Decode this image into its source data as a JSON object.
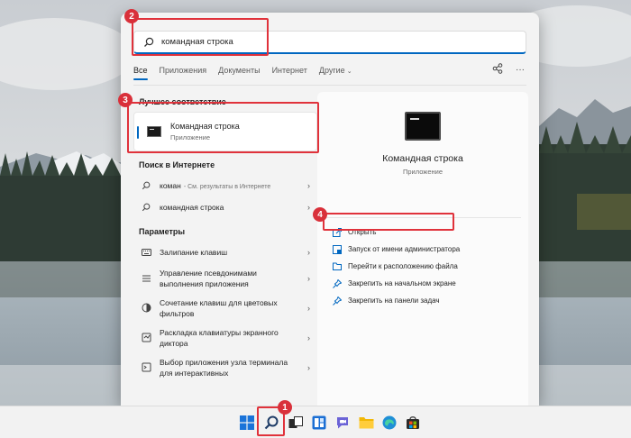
{
  "search": {
    "query": "командная строка"
  },
  "tabs": [
    {
      "label": "Все"
    },
    {
      "label": "Приложения"
    },
    {
      "label": "Документы"
    },
    {
      "label": "Интернет"
    },
    {
      "label": "Другие"
    }
  ],
  "toolbar": {
    "more_label": "···"
  },
  "best_match": {
    "section_title": "Лучшее соответствие",
    "title": "Командная строка",
    "subtitle": "Приложение"
  },
  "web": {
    "section_title": "Поиск в Интернете",
    "items": [
      {
        "label": "коман",
        "hint": "- См. результаты в Интернете"
      },
      {
        "label": "командная строка",
        "hint": ""
      }
    ]
  },
  "settings": {
    "section_title": "Параметры",
    "items": [
      {
        "label": "Залипание клавиш"
      },
      {
        "label": "Управление псевдонимами выполнения приложения"
      },
      {
        "label": "Сочетание клавиш для цветовых фильтров"
      },
      {
        "label": "Раскладка клавиатуры экранного диктора"
      },
      {
        "label": "Выбор приложения узла терминала для интерактивных"
      }
    ]
  },
  "detail": {
    "title": "Командная строка",
    "subtitle": "Приложение",
    "actions": [
      {
        "label": "Открыть",
        "icon": "open-icon"
      },
      {
        "label": "Запуск от имени администратора",
        "icon": "shield-icon"
      },
      {
        "label": "Перейти к расположению файла",
        "icon": "folder-icon"
      },
      {
        "label": "Закрепить на начальном экране",
        "icon": "pin-icon"
      },
      {
        "label": "Закрепить на панели задач",
        "icon": "pin-icon"
      }
    ]
  },
  "annotations": [
    "1",
    "2",
    "3",
    "4"
  ],
  "colors": {
    "accent": "#0067c0",
    "highlight": "#e0323b",
    "badge": "#d9303a"
  }
}
